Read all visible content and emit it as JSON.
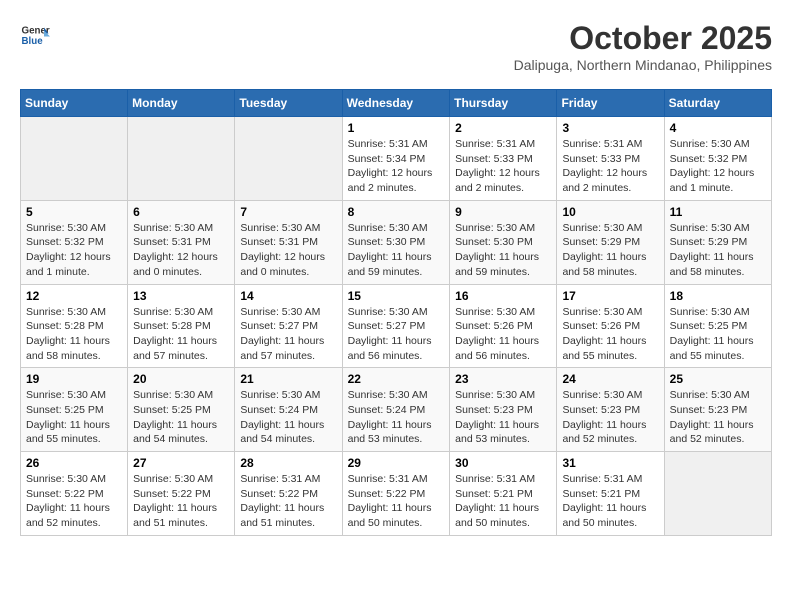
{
  "header": {
    "logo_line1": "General",
    "logo_line2": "Blue",
    "month": "October 2025",
    "location": "Dalipuga, Northern Mindanao, Philippines"
  },
  "weekdays": [
    "Sunday",
    "Monday",
    "Tuesday",
    "Wednesday",
    "Thursday",
    "Friday",
    "Saturday"
  ],
  "weeks": [
    [
      {
        "day": "",
        "info": ""
      },
      {
        "day": "",
        "info": ""
      },
      {
        "day": "",
        "info": ""
      },
      {
        "day": "1",
        "info": "Sunrise: 5:31 AM\nSunset: 5:34 PM\nDaylight: 12 hours and 2 minutes."
      },
      {
        "day": "2",
        "info": "Sunrise: 5:31 AM\nSunset: 5:33 PM\nDaylight: 12 hours and 2 minutes."
      },
      {
        "day": "3",
        "info": "Sunrise: 5:31 AM\nSunset: 5:33 PM\nDaylight: 12 hours and 2 minutes."
      },
      {
        "day": "4",
        "info": "Sunrise: 5:30 AM\nSunset: 5:32 PM\nDaylight: 12 hours and 1 minute."
      }
    ],
    [
      {
        "day": "5",
        "info": "Sunrise: 5:30 AM\nSunset: 5:32 PM\nDaylight: 12 hours and 1 minute."
      },
      {
        "day": "6",
        "info": "Sunrise: 5:30 AM\nSunset: 5:31 PM\nDaylight: 12 hours and 0 minutes."
      },
      {
        "day": "7",
        "info": "Sunrise: 5:30 AM\nSunset: 5:31 PM\nDaylight: 12 hours and 0 minutes."
      },
      {
        "day": "8",
        "info": "Sunrise: 5:30 AM\nSunset: 5:30 PM\nDaylight: 11 hours and 59 minutes."
      },
      {
        "day": "9",
        "info": "Sunrise: 5:30 AM\nSunset: 5:30 PM\nDaylight: 11 hours and 59 minutes."
      },
      {
        "day": "10",
        "info": "Sunrise: 5:30 AM\nSunset: 5:29 PM\nDaylight: 11 hours and 58 minutes."
      },
      {
        "day": "11",
        "info": "Sunrise: 5:30 AM\nSunset: 5:29 PM\nDaylight: 11 hours and 58 minutes."
      }
    ],
    [
      {
        "day": "12",
        "info": "Sunrise: 5:30 AM\nSunset: 5:28 PM\nDaylight: 11 hours and 58 minutes."
      },
      {
        "day": "13",
        "info": "Sunrise: 5:30 AM\nSunset: 5:28 PM\nDaylight: 11 hours and 57 minutes."
      },
      {
        "day": "14",
        "info": "Sunrise: 5:30 AM\nSunset: 5:27 PM\nDaylight: 11 hours and 57 minutes."
      },
      {
        "day": "15",
        "info": "Sunrise: 5:30 AM\nSunset: 5:27 PM\nDaylight: 11 hours and 56 minutes."
      },
      {
        "day": "16",
        "info": "Sunrise: 5:30 AM\nSunset: 5:26 PM\nDaylight: 11 hours and 56 minutes."
      },
      {
        "day": "17",
        "info": "Sunrise: 5:30 AM\nSunset: 5:26 PM\nDaylight: 11 hours and 55 minutes."
      },
      {
        "day": "18",
        "info": "Sunrise: 5:30 AM\nSunset: 5:25 PM\nDaylight: 11 hours and 55 minutes."
      }
    ],
    [
      {
        "day": "19",
        "info": "Sunrise: 5:30 AM\nSunset: 5:25 PM\nDaylight: 11 hours and 55 minutes."
      },
      {
        "day": "20",
        "info": "Sunrise: 5:30 AM\nSunset: 5:25 PM\nDaylight: 11 hours and 54 minutes."
      },
      {
        "day": "21",
        "info": "Sunrise: 5:30 AM\nSunset: 5:24 PM\nDaylight: 11 hours and 54 minutes."
      },
      {
        "day": "22",
        "info": "Sunrise: 5:30 AM\nSunset: 5:24 PM\nDaylight: 11 hours and 53 minutes."
      },
      {
        "day": "23",
        "info": "Sunrise: 5:30 AM\nSunset: 5:23 PM\nDaylight: 11 hours and 53 minutes."
      },
      {
        "day": "24",
        "info": "Sunrise: 5:30 AM\nSunset: 5:23 PM\nDaylight: 11 hours and 52 minutes."
      },
      {
        "day": "25",
        "info": "Sunrise: 5:30 AM\nSunset: 5:23 PM\nDaylight: 11 hours and 52 minutes."
      }
    ],
    [
      {
        "day": "26",
        "info": "Sunrise: 5:30 AM\nSunset: 5:22 PM\nDaylight: 11 hours and 52 minutes."
      },
      {
        "day": "27",
        "info": "Sunrise: 5:30 AM\nSunset: 5:22 PM\nDaylight: 11 hours and 51 minutes."
      },
      {
        "day": "28",
        "info": "Sunrise: 5:31 AM\nSunset: 5:22 PM\nDaylight: 11 hours and 51 minutes."
      },
      {
        "day": "29",
        "info": "Sunrise: 5:31 AM\nSunset: 5:22 PM\nDaylight: 11 hours and 50 minutes."
      },
      {
        "day": "30",
        "info": "Sunrise: 5:31 AM\nSunset: 5:21 PM\nDaylight: 11 hours and 50 minutes."
      },
      {
        "day": "31",
        "info": "Sunrise: 5:31 AM\nSunset: 5:21 PM\nDaylight: 11 hours and 50 minutes."
      },
      {
        "day": "",
        "info": ""
      }
    ]
  ]
}
